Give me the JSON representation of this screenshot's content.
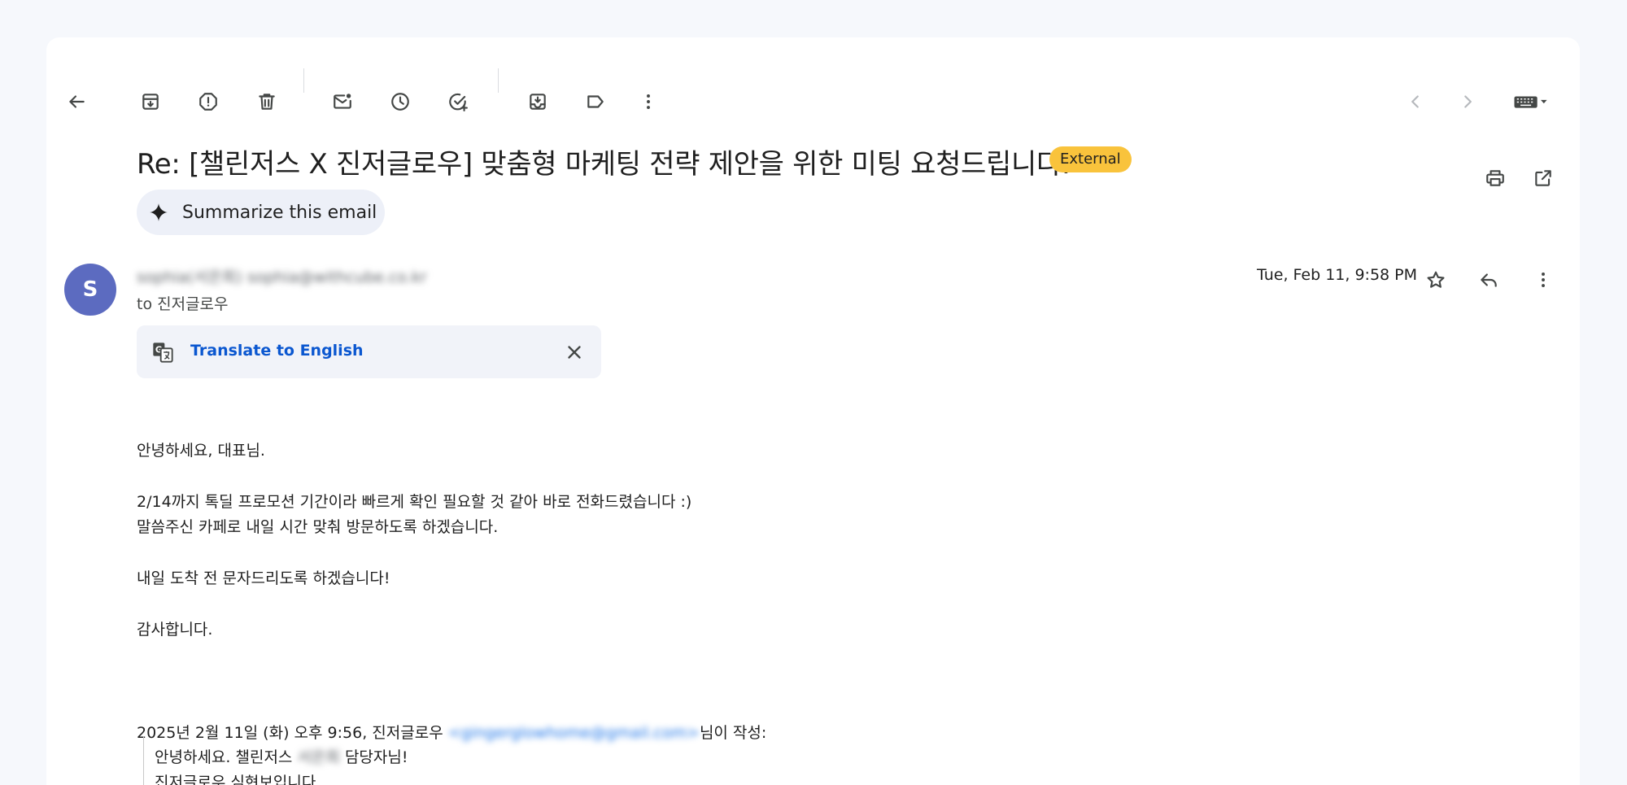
{
  "subject": "Re: [챌린저스 X 진저글로우] 맞춤형 마케팅 전략 제안을 위한 미팅 요청드립니다.",
  "badge": "External",
  "summarize_label": "Summarize this email",
  "avatar_letter": "S",
  "sender_blurred": "sophia(서은희) sophia@withcube.co.kr",
  "recipient": "to 진저글로우",
  "date": "Tue, Feb 11, 9:58 PM",
  "translate_label": "Translate to English",
  "body_lines": [
    "안녕하세요, 대표님.",
    "2/14까지 톡딜 프로모션 기간이라 빠르게 확인 필요할 것 같아 바로 전화드렸습니다 :)",
    "말씀주신 카페로 내일 시간 맞춰 방문하도록 하겠습니다.",
    "내일 도착 전 문자드리도록 하겠습니다!",
    "감사합니다."
  ],
  "quote_header_prefix": "2025년 2월 11일 (화) 오후 9:56, 진저글로우 ",
  "quote_header_email_blurred": "<gingerglowhome@gmail.com>",
  "quote_header_suffix": "님이 작성:",
  "quote_line1_prefix": "안녕하세요. 챌린저스 ",
  "quote_line1_blurred": "서은희",
  "quote_line1_suffix": " 담당자님!",
  "quote_line2": "진저글로우 심현보입니다.",
  "icons": [
    "back-arrow-icon",
    "archive-icon",
    "report-spam-icon",
    "delete-icon",
    "mark-unread-icon",
    "snooze-icon",
    "add-task-icon",
    "move-to-icon",
    "label-icon",
    "more-vert-icon",
    "newer-chevron-icon",
    "older-chevron-icon",
    "keyboard-icon",
    "print-icon",
    "open-new-window-icon",
    "sparkle-icon",
    "star-icon",
    "reply-icon",
    "translate-icon",
    "close-icon"
  ],
  "colors": {
    "background": "#f6f8fc",
    "panel": "#ffffff",
    "badge": "#f9c33c",
    "avatar": "#5c6bc0",
    "link": "#0b57d0",
    "summarize_bg": "#edf0f8",
    "translate_bg": "#f1f3f9"
  }
}
